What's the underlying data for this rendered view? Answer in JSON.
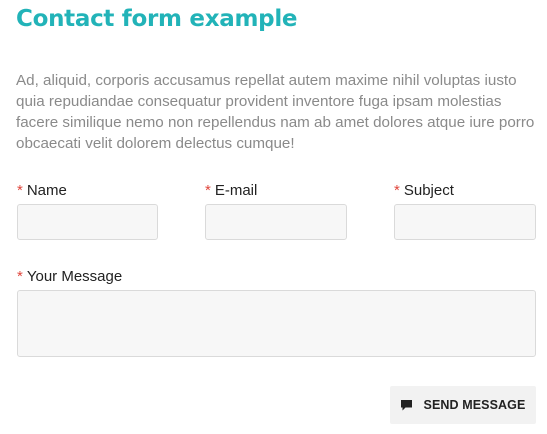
{
  "page": {
    "title": "Contact form example",
    "intro": "Ad, aliquid, corporis accusamus repellat autem maxime nihil voluptas iusto quia repudiandae consequatur provident inventore fuga ipsam molestias facere similique nemo non repellendus nam ab amet dolores atque iure porro obcaecati velit dolorem delectus cumque!"
  },
  "form": {
    "required_marker": "*",
    "name_label": "Name",
    "email_label": "E-mail",
    "subject_label": "Subject",
    "message_label": "Your Message",
    "name_value": "",
    "email_value": "",
    "subject_value": "",
    "message_value": "",
    "submit_label": "SEND MESSAGE",
    "submit_icon": "speech-bubble-icon"
  },
  "colors": {
    "accent": "#22b3b8",
    "required": "#e0463c",
    "input_bg": "#f7f7f7",
    "input_border": "#dadada",
    "button_bg": "#f2f2f2"
  }
}
